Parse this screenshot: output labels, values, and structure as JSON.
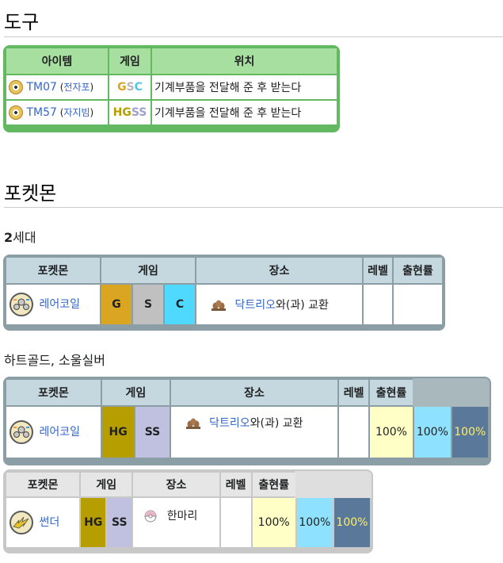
{
  "section_items": {
    "title": "도구",
    "headers": {
      "item": "아이템",
      "game": "게임",
      "location": "위치"
    },
    "rows": [
      {
        "tm": "TM07",
        "paren_open": " (",
        "move": "전자포",
        "paren_close": ")",
        "game_a": "G",
        "game_b": "S",
        "game_c": "C",
        "location": "기계부품을 전달해 준 후 받는다"
      },
      {
        "tm": "TM57",
        "paren_open": " (",
        "move": "자지빔",
        "paren_close": ")",
        "game_a": "HG",
        "game_b": "SS",
        "game_c": "",
        "location": "기계부품을 전달해 준 후 받는다"
      }
    ]
  },
  "section_pokemon": {
    "title": "포켓몬",
    "gen2": {
      "title": "2세대",
      "title_bold": "2",
      "title_rest": "세대",
      "headers": {
        "pokemon": "포켓몬",
        "game": "게임",
        "place": "장소",
        "level": "레벨",
        "rate": "출현률"
      },
      "row": {
        "pokemon": "레어코일",
        "games": [
          "G",
          "S",
          "C"
        ],
        "trade_with": "닥트리오",
        "trade_text": "와(과) 교환"
      }
    },
    "hgss": {
      "title": "하트골드, 소울실버",
      "headers": {
        "pokemon": "포켓몬",
        "game": "게임",
        "place": "장소",
        "level": "레벨",
        "rate": "출현률"
      },
      "row": {
        "pokemon": "레어코일",
        "games": [
          "HG",
          "SS"
        ],
        "trade_with": "닥트리오",
        "trade_text": "와(과) 교환",
        "rates": [
          "100%",
          "100%",
          "100%"
        ]
      },
      "row2": {
        "pokemon": "썬더",
        "games": [
          "HG",
          "SS"
        ],
        "place": "한마리",
        "rates": [
          "100%",
          "100%",
          "100%"
        ]
      }
    }
  },
  "colors": {
    "green_border": "#5cb85c",
    "green_header": "#a6dfa0",
    "gen2_border": "#8c9ea5",
    "gen2_header": "#c5d8e0",
    "hgss2_border": "#bdbdbd",
    "gold": "#daa520",
    "silver": "#c0c0c0",
    "crystal": "#4fd9ff",
    "hg": "#b69e00",
    "ss": "#c0c0e0"
  }
}
